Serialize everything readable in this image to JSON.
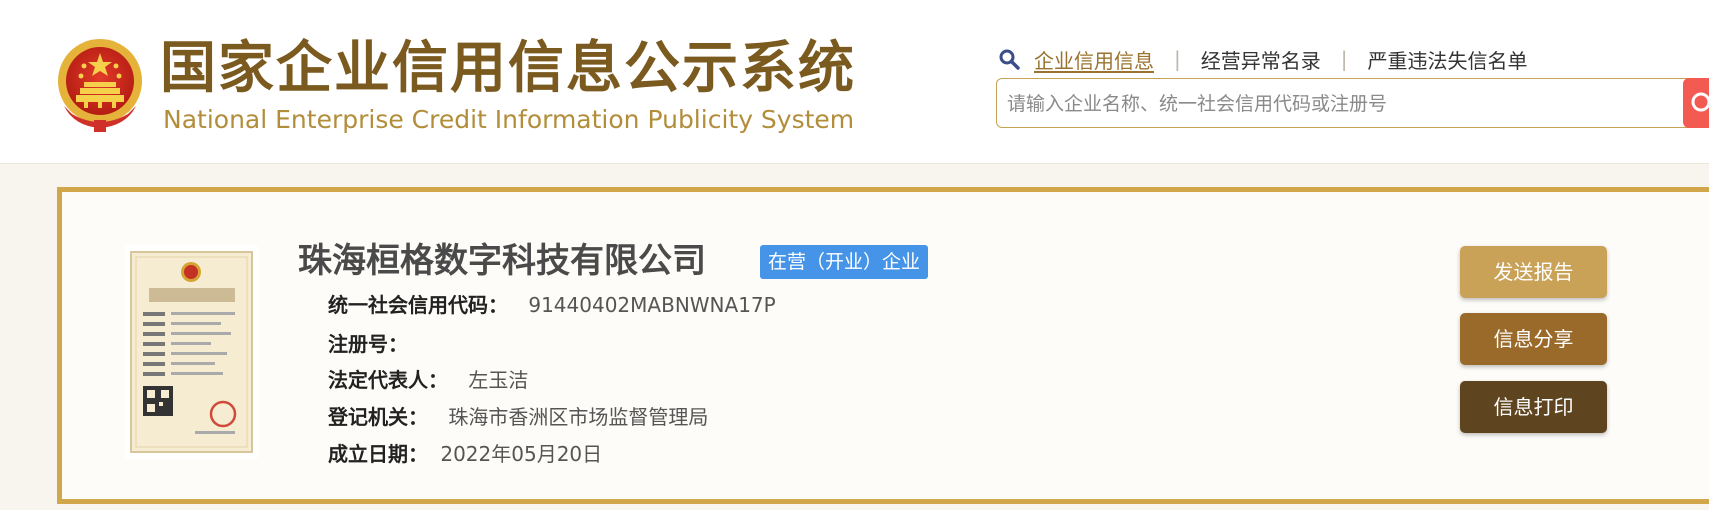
{
  "header": {
    "title_cn": "国家企业信用信息公示系统",
    "title_en": "National Enterprise Credit Information Publicity System",
    "logo_icon": "national-emblem-icon"
  },
  "nav": {
    "search_icon": "search-icon",
    "items": [
      {
        "label": "企业信用信息",
        "active": true
      },
      {
        "label": "经营异常名录",
        "active": false
      },
      {
        "label": "严重违法失信名单",
        "active": false
      }
    ],
    "separator": "|"
  },
  "search": {
    "value": "",
    "placeholder": "请输入企业名称、统一社会信用代码或注册号"
  },
  "company": {
    "name": "珠海桓格数字科技有限公司",
    "status": "在营（开业）企业",
    "license_icon": "business-license-icon",
    "fields": [
      {
        "label": "统一社会信用代码：",
        "value": "91440402MABNWNA17P"
      },
      {
        "label": "注册号：",
        "value": ""
      },
      {
        "label": "法定代表人：",
        "value": "左玉洁"
      },
      {
        "label": "登记机关：",
        "value": "珠海市香洲区市场监督管理局"
      },
      {
        "label": "成立日期：",
        "value": "2022年05月20日"
      }
    ]
  },
  "actions": {
    "send_report": "发送报告",
    "share": "信息分享",
    "print": "信息打印"
  },
  "colors": {
    "brand_brown": "#7b5a1f",
    "brand_gold": "#d2a64a",
    "status_blue": "#4694e8",
    "btn_send": "#c9a157",
    "btn_share": "#9a6a2a",
    "btn_print": "#5f451f",
    "search_red": "#f25a52"
  }
}
